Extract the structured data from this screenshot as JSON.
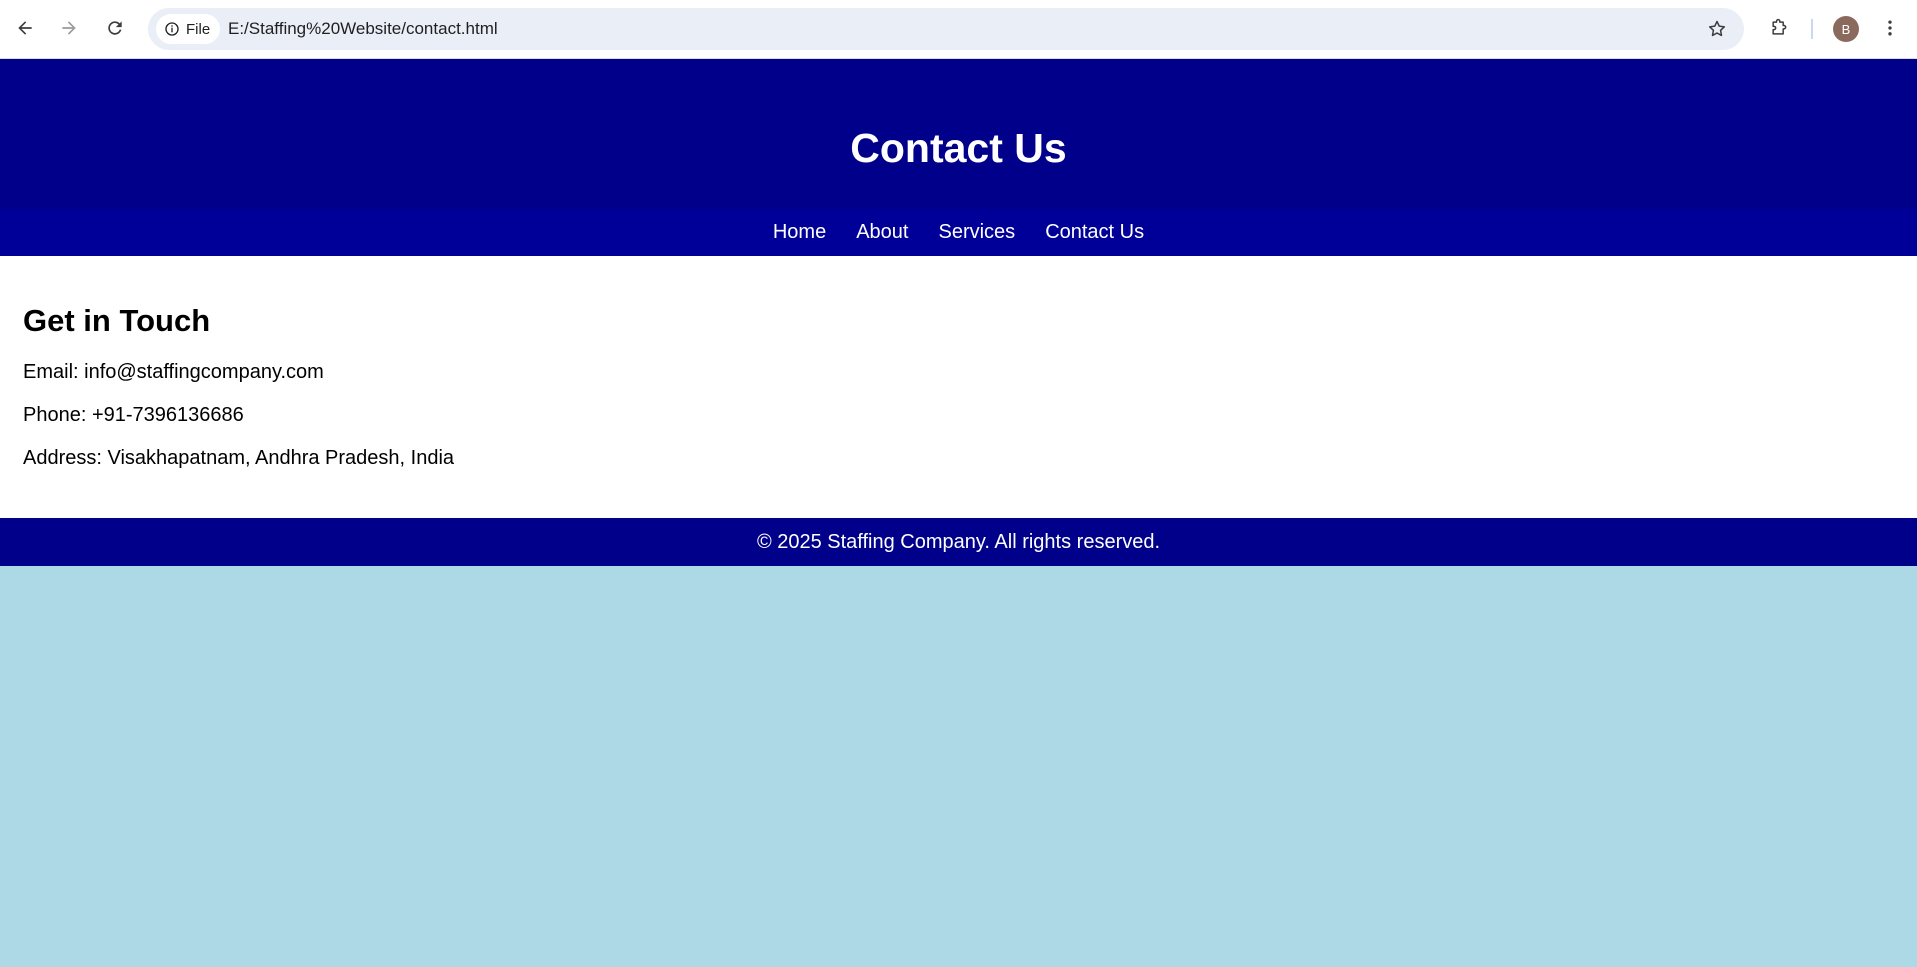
{
  "browser": {
    "site_chip_label": "File",
    "url": "E:/Staffing%20Website/contact.html",
    "profile_initial": "B",
    "icons": {
      "back": "arrow-left-icon",
      "forward": "arrow-right-icon",
      "reload": "reload-icon",
      "info": "info-icon",
      "bookmark": "star-icon",
      "extensions": "puzzle-icon",
      "menu": "kebab-menu-icon"
    }
  },
  "header": {
    "title": "Contact Us"
  },
  "nav": {
    "items": [
      {
        "label": "Home"
      },
      {
        "label": "About"
      },
      {
        "label": "Services"
      },
      {
        "label": "Contact Us"
      }
    ]
  },
  "main": {
    "heading": "Get in Touch",
    "email": "Email: info@staffingcompany.com",
    "phone": "Phone: +91-7396136686",
    "address": "Address: Visakhapatnam, Andhra Pradesh, India"
  },
  "footer": {
    "text": "© 2025 Staffing Company. All rights reserved."
  },
  "colors": {
    "header_bg": "#00008b",
    "nav_bg": "#000099",
    "page_bg": "#add8e6",
    "content_bg": "#ffffff"
  }
}
